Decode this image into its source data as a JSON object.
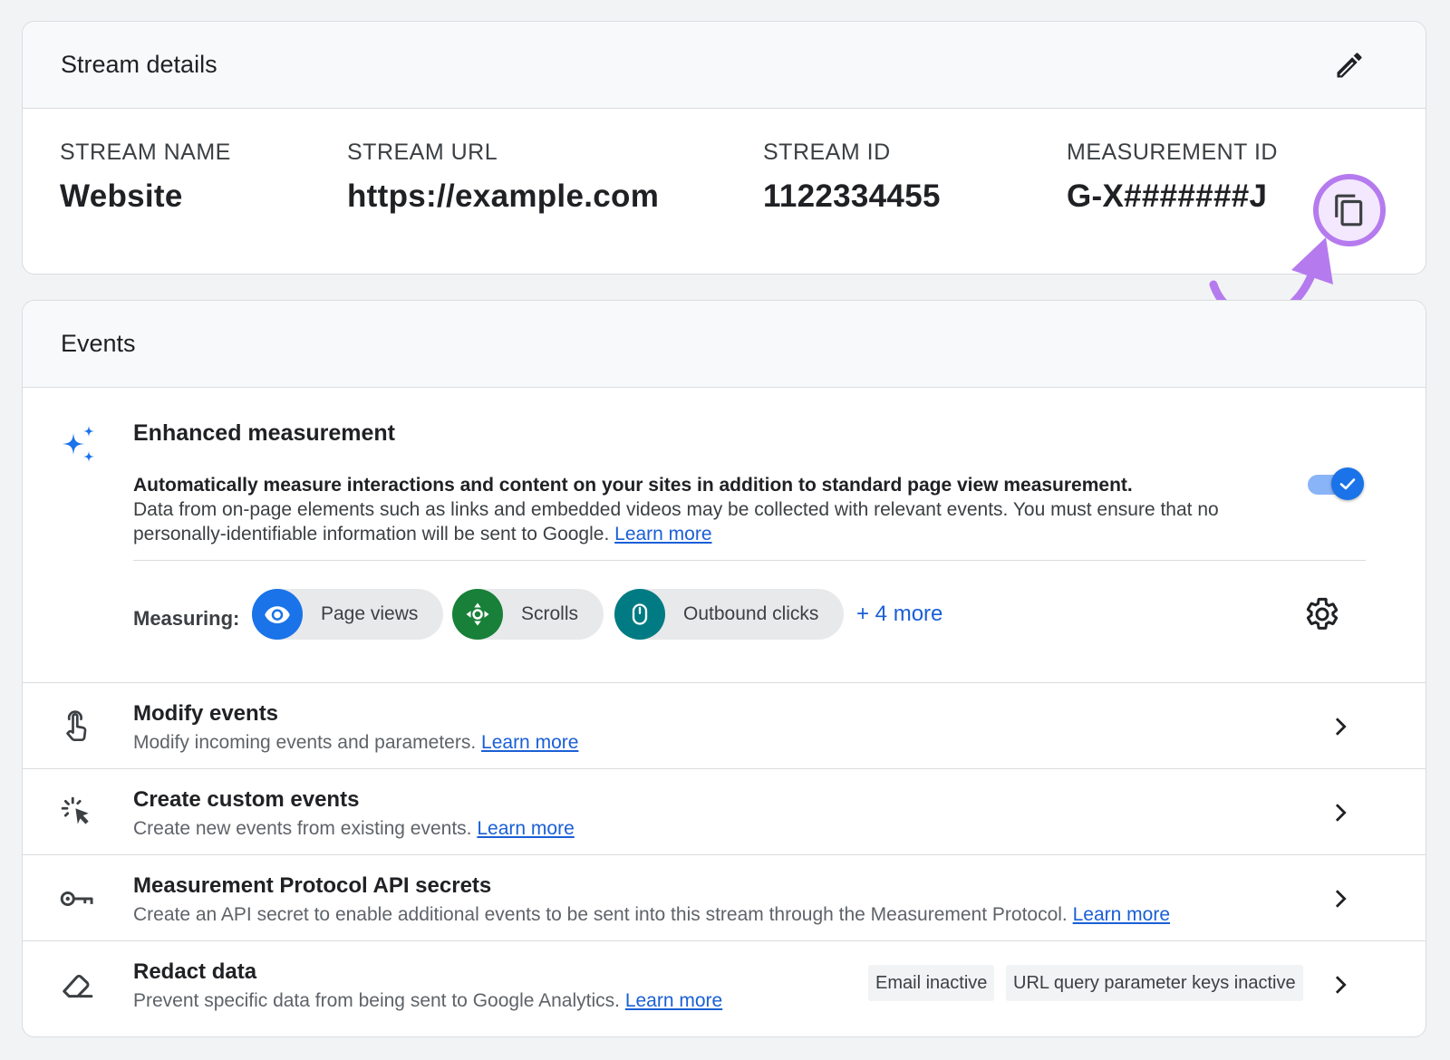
{
  "stream": {
    "title": "Stream details",
    "fields": [
      {
        "label": "STREAM NAME",
        "value": "Website"
      },
      {
        "label": "STREAM URL",
        "value": "https://example.com"
      },
      {
        "label": "STREAM ID",
        "value": "1122334455"
      },
      {
        "label": "MEASUREMENT ID",
        "value": "G-X#######J"
      }
    ]
  },
  "events": {
    "title": "Events",
    "enhanced": {
      "title": "Enhanced measurement",
      "desc_bold": "Automatically measure interactions and content on your sites in addition to standard page view measurement.",
      "desc": "Data from on-page elements such as links and embedded videos may be collected with relevant events. You must ensure that no personally-identifiable information will be sent to Google.",
      "link": "Learn more",
      "toggle_on": true,
      "measuring_label": "Measuring:",
      "chips": [
        {
          "label": "Page views",
          "color": "#1a73e8"
        },
        {
          "label": "Scrolls",
          "color": "#188038"
        },
        {
          "label": "Outbound clicks",
          "color": "#007b83"
        }
      ],
      "more": "+ 4 more"
    },
    "rows": [
      {
        "title": "Modify events",
        "desc": "Modify incoming events and parameters.",
        "link": "Learn more"
      },
      {
        "title": "Create custom events",
        "desc": "Create new events from existing events.",
        "link": "Learn more"
      },
      {
        "title": "Measurement Protocol API secrets",
        "desc": "Create an API secret to enable additional events to be sent into this stream through the Measurement Protocol.",
        "link": "Learn more"
      },
      {
        "title": "Redact data",
        "desc": "Prevent specific data from being sent to Google Analytics.",
        "link": "Learn more",
        "badges": [
          "Email inactive",
          "URL query parameter keys inactive"
        ]
      }
    ]
  },
  "colors": {
    "accent": "#1a73e8",
    "link": "#1a5fd6",
    "highlight": "#b57bee"
  }
}
